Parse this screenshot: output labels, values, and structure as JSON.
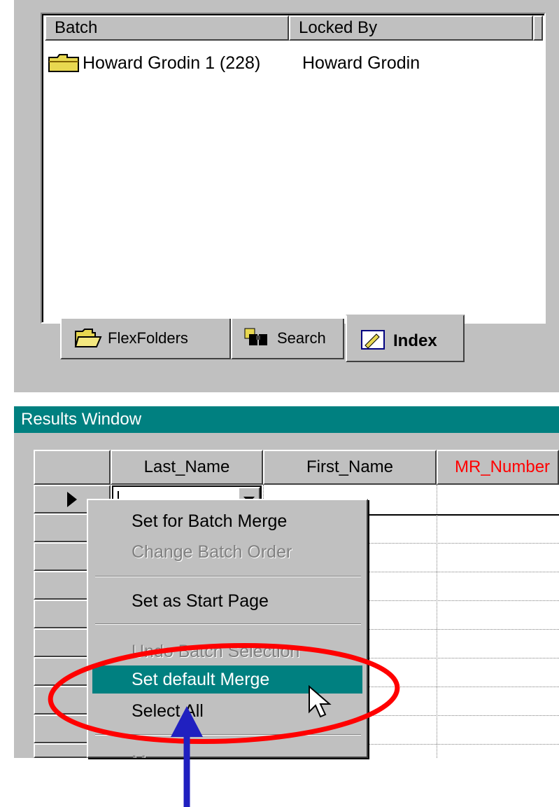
{
  "batch_panel": {
    "columns": [
      "Batch",
      "Locked By"
    ],
    "rows": [
      {
        "batch": "Howard Grodin 1 (228)",
        "locked_by": "Howard Grodin"
      }
    ]
  },
  "tabs": [
    {
      "label": "FlexFolders",
      "icon": "open-folder-icon"
    },
    {
      "label": "Search",
      "icon": "binoculars-icon"
    },
    {
      "label": "Index",
      "icon": "index-card-icon"
    }
  ],
  "results": {
    "title": "Results Window",
    "columns": [
      "Last_Name",
      "First_Name",
      "MR_Number"
    ],
    "mr_color": "#ff0000"
  },
  "context_menu": {
    "items": [
      {
        "label": "Set for Batch Merge",
        "enabled": true
      },
      {
        "label": "Change Batch Order",
        "enabled": false
      },
      {
        "label": "Set as Start Page",
        "enabled": true
      },
      {
        "label": "Undo Batch Selection",
        "enabled": false
      },
      {
        "label": "Set default Merge",
        "enabled": true,
        "highlighted": true
      },
      {
        "label": "Select All",
        "enabled": true
      },
      {
        "label": "Merge",
        "enabled": false
      }
    ]
  },
  "annotation": {
    "ellipse_color": "#ff0000",
    "arrow_color": "#2020c0"
  }
}
